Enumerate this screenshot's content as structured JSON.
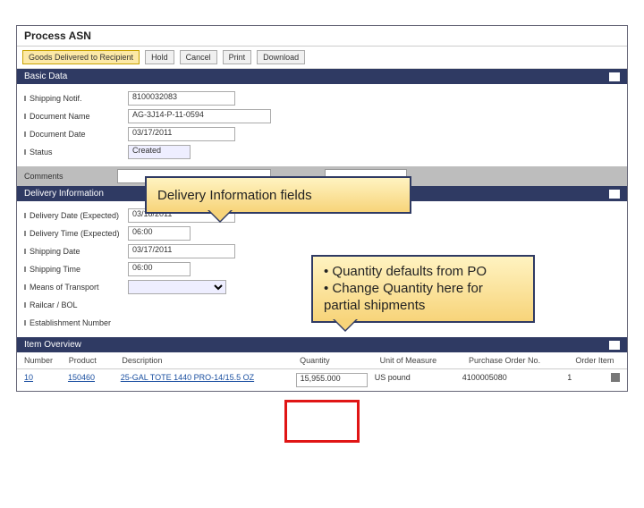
{
  "page": {
    "title": "Process ASN"
  },
  "toolbar": {
    "deliver": "Goods Delivered to Recipient",
    "hold": "Hold",
    "cancel": "Cancel",
    "print": "Print",
    "download": "Download"
  },
  "sections": {
    "basic": "Basic Data",
    "delivery": "Delivery Information",
    "items": "Item Overview"
  },
  "basic": {
    "lbl_notif": "Shipping Notif.",
    "val_notif": "8100032083",
    "lbl_docname": "Document Name",
    "val_docname": "AG-3J14-P-11-0594",
    "lbl_docdate": "Document Date",
    "val_docdate": "03/17/2011",
    "lbl_status": "Status",
    "val_status": "Created",
    "comments": "Comments"
  },
  "delivery": {
    "lbl_ddate": "Delivery Date (Expected)",
    "val_ddate": "03/18/2011",
    "lbl_dtime": "Delivery Time (Expected)",
    "val_dtime": "06:00",
    "lbl_sdate": "Shipping Date",
    "val_sdate": "03/17/2011",
    "lbl_stime": "Shipping Time",
    "val_stime": "06:00",
    "lbl_mot": "Means of Transport",
    "lbl_bol": "Railcar / BOL",
    "lbl_est": "Establishment Number"
  },
  "items": {
    "h_num": "Number",
    "h_prod": "Product",
    "h_desc": "Description",
    "h_qty": "Quantity",
    "h_uom": "Unit of Measure",
    "h_po": "Purchase Order No.",
    "h_oi": "Order Item",
    "r1": {
      "num": "10",
      "prod": "150460",
      "desc": "25-GAL TOTE 1440 PRO-14/15.5 OZ",
      "qty": "15,955.000",
      "uom": "US pound",
      "po": "4100005080",
      "oi": "1"
    }
  },
  "callouts": {
    "c1": "Delivery Information fields",
    "c2a": "• Quantity defaults from PO",
    "c2b": "• Change Quantity here for partial shipments"
  }
}
